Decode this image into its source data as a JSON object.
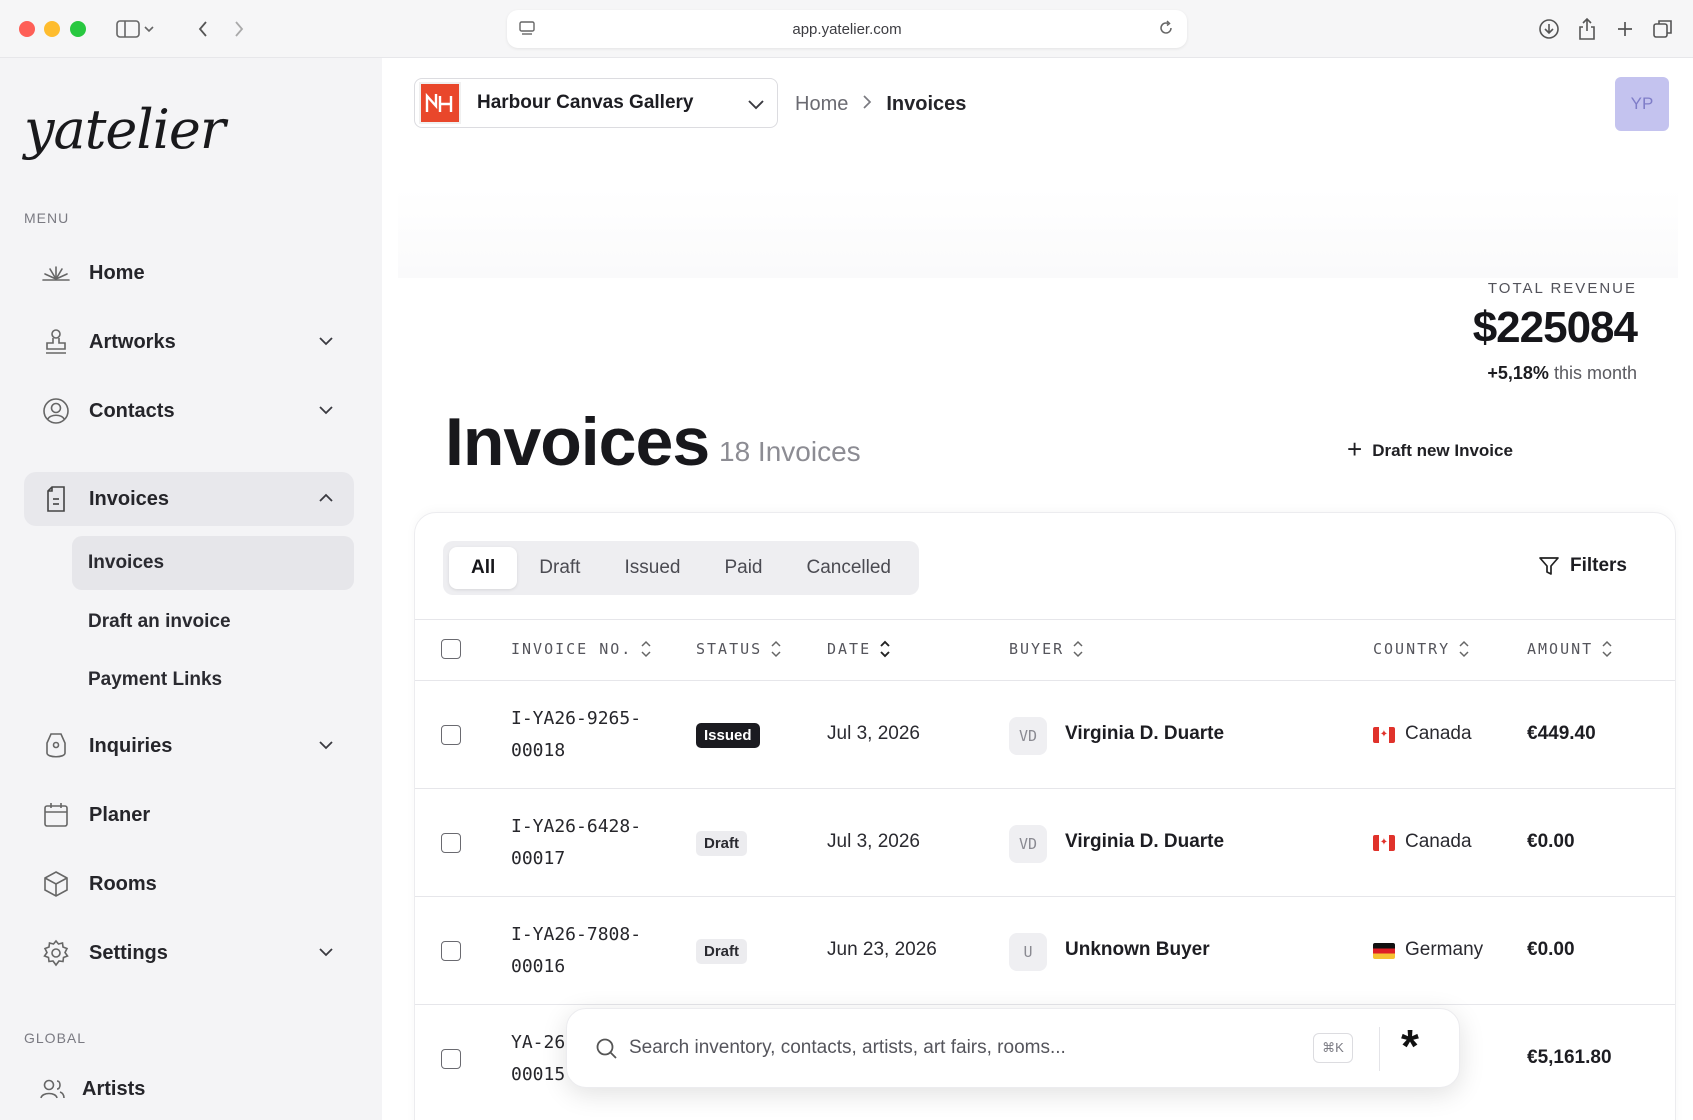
{
  "browser": {
    "url": "app.yatelier.com"
  },
  "sidebar": {
    "logo": "yatelier",
    "menu_label": "MENU",
    "items": [
      {
        "label": "Home",
        "icon": "home-burst-icon"
      },
      {
        "label": "Artworks",
        "icon": "stamp-icon"
      },
      {
        "label": "Contacts",
        "icon": "user-circle-icon"
      },
      {
        "label": "Invoices",
        "icon": "invoice-icon"
      },
      {
        "label": "Inquiries",
        "icon": "tag-icon"
      },
      {
        "label": "Planer",
        "icon": "calendar-icon"
      },
      {
        "label": "Rooms",
        "icon": "cube-icon"
      },
      {
        "label": "Settings",
        "icon": "gear-icon"
      }
    ],
    "invoice_subitems": [
      "Invoices",
      "Draft an invoice",
      "Payment Links"
    ],
    "global_label": "GLOBAL",
    "global_items": [
      {
        "label": "Artists",
        "icon": "users-icon"
      }
    ]
  },
  "header": {
    "gallery": "Harbour Canvas Gallery",
    "breadcrumb": {
      "home": "Home",
      "current": "Invoices"
    },
    "avatar_initials": "YP"
  },
  "revenue": {
    "label": "TOTAL REVENUE",
    "value": "$225084",
    "change": "+5,18%",
    "change_suffix": "this month"
  },
  "page": {
    "title": "Invoices",
    "count": "18 Invoices",
    "draft_button": "Draft new Invoice"
  },
  "tabs": [
    "All",
    "Draft",
    "Issued",
    "Paid",
    "Cancelled"
  ],
  "active_tab": "All",
  "filters_label": "Filters",
  "table": {
    "columns": [
      "INVOICE NO.",
      "STATUS",
      "DATE",
      "BUYER",
      "COUNTRY",
      "AMOUNT"
    ],
    "rows": [
      {
        "invoice_line1": "I-YA26-9265-",
        "invoice_line2": "00018",
        "status": "Issued",
        "date": "Jul 3, 2026",
        "buyer_initials": "VD",
        "buyer": "Virginia D. Duarte",
        "country": "Canada",
        "amount": "€449.40"
      },
      {
        "invoice_line1": "I-YA26-6428-",
        "invoice_line2": "00017",
        "status": "Draft",
        "date": "Jul 3, 2026",
        "buyer_initials": "VD",
        "buyer": "Virginia D. Duarte",
        "country": "Canada",
        "amount": "€0.00"
      },
      {
        "invoice_line1": "I-YA26-7808-",
        "invoice_line2": "00016",
        "status": "Draft",
        "date": "Jun 23, 2026",
        "buyer_initials": "U",
        "buyer": "Unknown Buyer",
        "country": "Germany",
        "amount": "€0.00"
      },
      {
        "invoice_line1": "YA-26",
        "invoice_line2": "00015",
        "amount": "€5,161.80"
      }
    ]
  },
  "search": {
    "placeholder": "Search inventory, contacts, artists, art fairs, rooms...",
    "shortcut": "⌘K"
  },
  "colors": {
    "accent_logo": "#e9472b",
    "avatar_bg": "#c4c3ef",
    "issued_badge": "#1b1b20"
  }
}
